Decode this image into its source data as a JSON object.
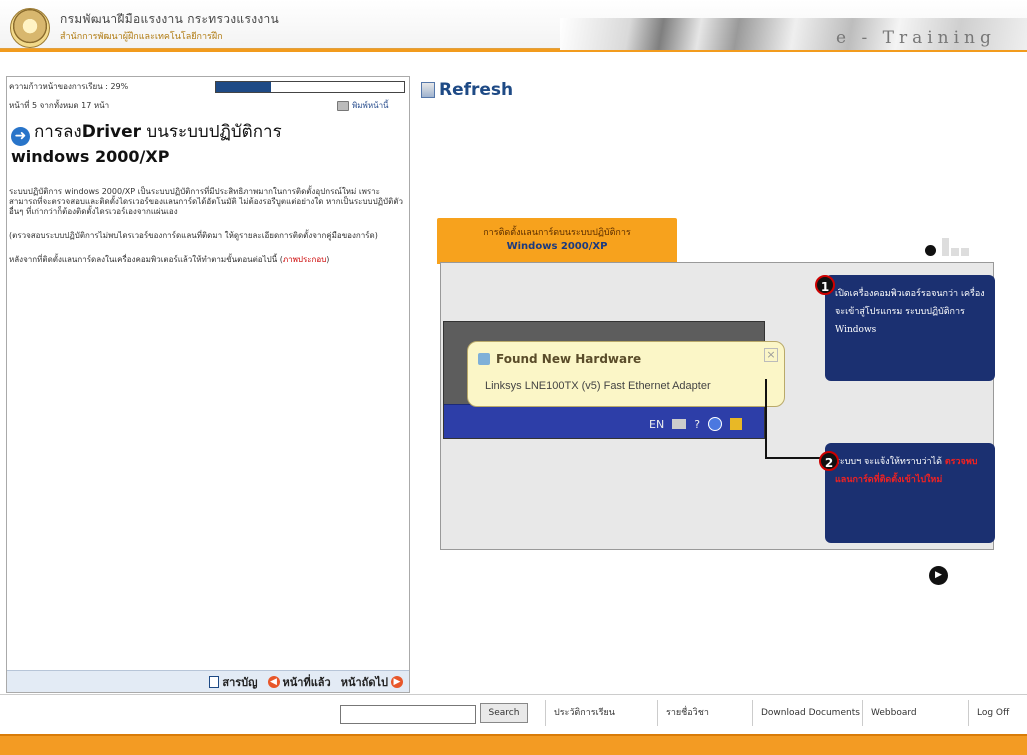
{
  "header": {
    "org_name": "กรมพัฒนาฝีมือแรงงาน กระทรวงแรงงาน",
    "org_sub": "สำนักการพัฒนาผู้ฝึกและเทคโนโลยีการฝึก",
    "banner_text": "e - Training"
  },
  "lesson": {
    "progress_label": "ความก้าวหน้าของการเรียน : 29%",
    "progress_value": 0.29,
    "page_info": "หน้าที่ 5 จากทั้งหมด 17 หน้า",
    "print_label": "พิมพ์หน้านี้",
    "title_prefix": "การลง",
    "title_bold": "Driver",
    "title_rest": " บนระบบปฏิบัติการ",
    "title_line2": "windows 2000/XP",
    "para1": "ระบบปฏิบัติการ windows 2000/XP เป็นระบบปฏิบัติการที่มีประสิทธิภาพมากในการติดตั้งอุปกรณ์ใหม่ เพราะสามารถที่จะตรวจสอบและติดตั้งไดรเวอร์ของแลนการ์ดได้อัตโนมัติ ไม่ต้องรอรีบูตแต่อย่างใด หากเป็นระบบปฏิบัติตัวอื่นๆ ที่เก่ากว่าก็ต้องติดตั้งไดรเวอร์เองจากแผ่นเอง",
    "para2": "(ตรวจสอบระบบปฏิบัติการไม่พบไดรเวอร์ของการ์ดแลนที่ติดมา ให้ดูรายละเอียดการติดตั้งจากคู่มือของการ์ด)",
    "para3_text": "หลังจากที่ติดตั้งแลนการ์ดลงในเครื่องคอมพิวเตอร์แล้วให้ทำตามขั้นตอนต่อไปนี้ (",
    "para3_link": "ภาพประกอบ",
    "para3_end": ")",
    "nav_contents": "สารบัญ",
    "nav_prev": "หน้าที่แล้ว",
    "nav_next": "หน้าถัดไป"
  },
  "viewer": {
    "refresh_label": "Refresh",
    "slide_tab_line1": "การติดตั้งแลนการ์ดบนระบบปฏิบัติการ",
    "slide_tab_line2": "Windows 2000/XP",
    "balloon_title": "Found New Hardware",
    "balloon_text": "Linksys LNE100TX (v5) Fast Ethernet Adapter",
    "tray_lang": "EN",
    "step1_num": "1",
    "step1_text": "เปิดเครื่องคอมพิวเตอร์รอจนกว่า เครื่องจะเข้าสู่โปรแกรม ระบบปฏิบัติการ Windows",
    "step2_num": "2",
    "step2_text": "ระบบฯ จะแจ้งให้ทราบว่าได้",
    "step2_red": "ตรวจพบแลนการ์ดที่ติดตั้งเข้าไปใหม่"
  },
  "footer": {
    "search_button": "Search",
    "search_value": "",
    "nav": [
      "ประวัติการเรียน",
      "รายชื่อวิชา",
      "Download Documents",
      "Webboard",
      "Log Off"
    ]
  },
  "colors": {
    "accent_orange": "#f39b23",
    "navy": "#1b3071",
    "progress": "#1e4a85"
  }
}
